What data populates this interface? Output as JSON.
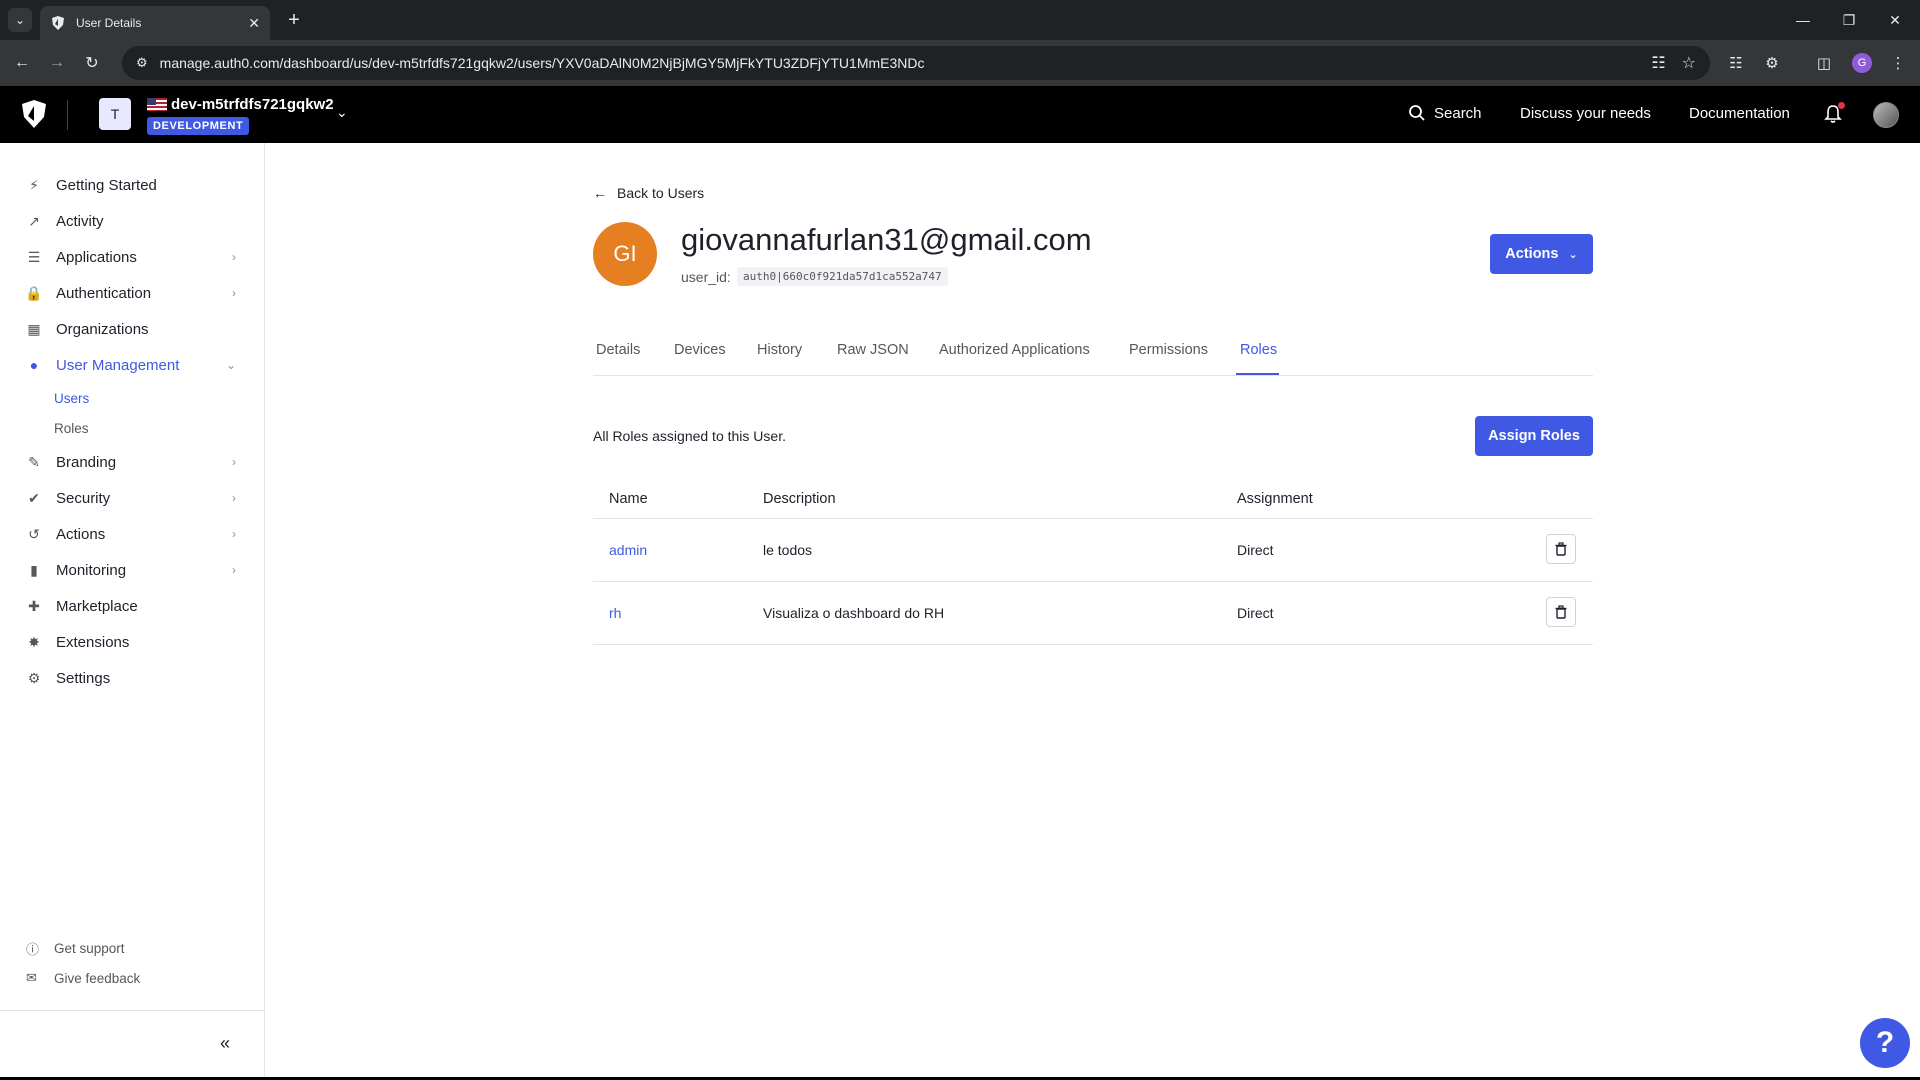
{
  "browser": {
    "tab_title": "User Details",
    "url": "manage.auth0.com/dashboard/us/dev-m5trfdfs721gqkw2/users/YXV0aDAlN0M2NjBjMGY5MjFkYTU3ZDFjYTU1MmE3NDc",
    "profile_initial": "G"
  },
  "header": {
    "tenant_initial": "T",
    "tenant_name": "dev-m5trfdfs721gqkw2",
    "tenant_env": "DEVELOPMENT",
    "search_label": "Search",
    "discuss_label": "Discuss your needs",
    "docs_label": "Documentation"
  },
  "sidebar": {
    "items": [
      {
        "label": "Getting Started",
        "icon": "bolt-icon"
      },
      {
        "label": "Activity",
        "icon": "chart-line-icon"
      },
      {
        "label": "Applications",
        "icon": "layers-icon"
      },
      {
        "label": "Authentication",
        "icon": "lock-icon"
      },
      {
        "label": "Organizations",
        "icon": "building-icon"
      },
      {
        "label": "User Management",
        "icon": "users-icon"
      },
      {
        "label": "Branding",
        "icon": "brush-icon"
      },
      {
        "label": "Security",
        "icon": "shield-check-icon"
      },
      {
        "label": "Actions",
        "icon": "flow-icon"
      },
      {
        "label": "Monitoring",
        "icon": "bar-chart-icon"
      },
      {
        "label": "Marketplace",
        "icon": "plus-grid-icon"
      },
      {
        "label": "Extensions",
        "icon": "extension-icon"
      },
      {
        "label": "Settings",
        "icon": "gear-icon"
      }
    ],
    "sub_items": [
      {
        "label": "Users"
      },
      {
        "label": "Roles"
      }
    ],
    "footer": [
      {
        "label": "Get support",
        "icon": "help-circle-icon"
      },
      {
        "label": "Give feedback",
        "icon": "feedback-icon"
      }
    ]
  },
  "main": {
    "back_label": "Back to Users",
    "avatar_initials": "GI",
    "email": "giovannafurlan31@gmail.com",
    "user_id_label": "user_id:",
    "user_id_value": "auth0|660c0f921da57d1ca552a747",
    "actions_label": "Actions",
    "tabs": [
      {
        "label": "Details"
      },
      {
        "label": "Devices"
      },
      {
        "label": "History"
      },
      {
        "label": "Raw JSON"
      },
      {
        "label": "Authorized Applications"
      },
      {
        "label": "Permissions"
      },
      {
        "label": "Roles"
      }
    ],
    "active_tab": "Roles",
    "roles_caption": "All Roles assigned to this User.",
    "assign_label": "Assign Roles",
    "table": {
      "columns": [
        "Name",
        "Description",
        "Assignment"
      ],
      "rows": [
        {
          "name": "admin",
          "description": "le todos",
          "assignment": "Direct"
        },
        {
          "name": "rh",
          "description": "Visualiza o dashboard do RH",
          "assignment": "Direct"
        }
      ]
    }
  },
  "help_label": "?",
  "colors": {
    "accent": "#3f59e4",
    "avatar": "#e67e22",
    "header_bg": "#000000"
  }
}
